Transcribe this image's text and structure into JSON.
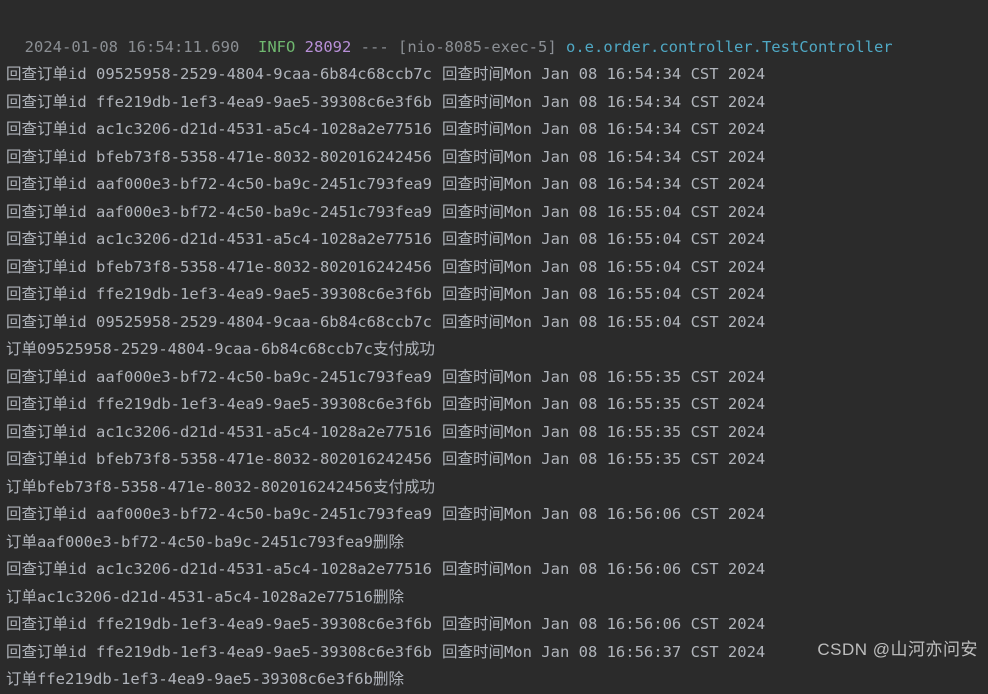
{
  "header": {
    "timestamp": "2024-01-08 16:54:11.690",
    "level": "INFO",
    "pid": "28092",
    "sep": "---",
    "thread": "[nio-8085-exec-5]",
    "logger": "o.e.order.controller.TestController"
  },
  "label_prefix": "回查订单id",
  "label_time": "回查时间",
  "lines": [
    {
      "type": "check",
      "id": "09525958-2529-4804-9caa-6b84c68ccb7c",
      "time": "Mon Jan 08 16:54:34 CST 2024"
    },
    {
      "type": "check",
      "id": "ffe219db-1ef3-4ea9-9ae5-39308c6e3f6b",
      "time": "Mon Jan 08 16:54:34 CST 2024"
    },
    {
      "type": "check",
      "id": "ac1c3206-d21d-4531-a5c4-1028a2e77516",
      "time": "Mon Jan 08 16:54:34 CST 2024"
    },
    {
      "type": "check",
      "id": "bfeb73f8-5358-471e-8032-802016242456",
      "time": "Mon Jan 08 16:54:34 CST 2024"
    },
    {
      "type": "check",
      "id": "aaf000e3-bf72-4c50-ba9c-2451c793fea9",
      "time": "Mon Jan 08 16:54:34 CST 2024"
    },
    {
      "type": "check",
      "id": "aaf000e3-bf72-4c50-ba9c-2451c793fea9",
      "time": "Mon Jan 08 16:55:04 CST 2024"
    },
    {
      "type": "check",
      "id": "ac1c3206-d21d-4531-a5c4-1028a2e77516",
      "time": "Mon Jan 08 16:55:04 CST 2024"
    },
    {
      "type": "check",
      "id": "bfeb73f8-5358-471e-8032-802016242456",
      "time": "Mon Jan 08 16:55:04 CST 2024"
    },
    {
      "type": "check",
      "id": "ffe219db-1ef3-4ea9-9ae5-39308c6e3f6b",
      "time": "Mon Jan 08 16:55:04 CST 2024"
    },
    {
      "type": "check",
      "id": "09525958-2529-4804-9caa-6b84c68ccb7c",
      "time": "Mon Jan 08 16:55:04 CST 2024"
    },
    {
      "type": "status",
      "text": "订单09525958-2529-4804-9caa-6b84c68ccb7c支付成功"
    },
    {
      "type": "check",
      "id": "aaf000e3-bf72-4c50-ba9c-2451c793fea9",
      "time": "Mon Jan 08 16:55:35 CST 2024"
    },
    {
      "type": "check",
      "id": "ffe219db-1ef3-4ea9-9ae5-39308c6e3f6b",
      "time": "Mon Jan 08 16:55:35 CST 2024"
    },
    {
      "type": "check",
      "id": "ac1c3206-d21d-4531-a5c4-1028a2e77516",
      "time": "Mon Jan 08 16:55:35 CST 2024"
    },
    {
      "type": "check",
      "id": "bfeb73f8-5358-471e-8032-802016242456",
      "time": "Mon Jan 08 16:55:35 CST 2024"
    },
    {
      "type": "status",
      "text": "订单bfeb73f8-5358-471e-8032-802016242456支付成功"
    },
    {
      "type": "check",
      "id": "aaf000e3-bf72-4c50-ba9c-2451c793fea9",
      "time": "Mon Jan 08 16:56:06 CST 2024"
    },
    {
      "type": "status",
      "text": "订单aaf000e3-bf72-4c50-ba9c-2451c793fea9删除"
    },
    {
      "type": "check",
      "id": "ac1c3206-d21d-4531-a5c4-1028a2e77516",
      "time": "Mon Jan 08 16:56:06 CST 2024"
    },
    {
      "type": "status",
      "text": "订单ac1c3206-d21d-4531-a5c4-1028a2e77516删除"
    },
    {
      "type": "check",
      "id": "ffe219db-1ef3-4ea9-9ae5-39308c6e3f6b",
      "time": "Mon Jan 08 16:56:06 CST 2024"
    },
    {
      "type": "check",
      "id": "ffe219db-1ef3-4ea9-9ae5-39308c6e3f6b",
      "time": "Mon Jan 08 16:56:37 CST 2024"
    },
    {
      "type": "status",
      "text": "订单ffe219db-1ef3-4ea9-9ae5-39308c6e3f6b删除"
    }
  ],
  "watermark": "CSDN @山河亦问安"
}
